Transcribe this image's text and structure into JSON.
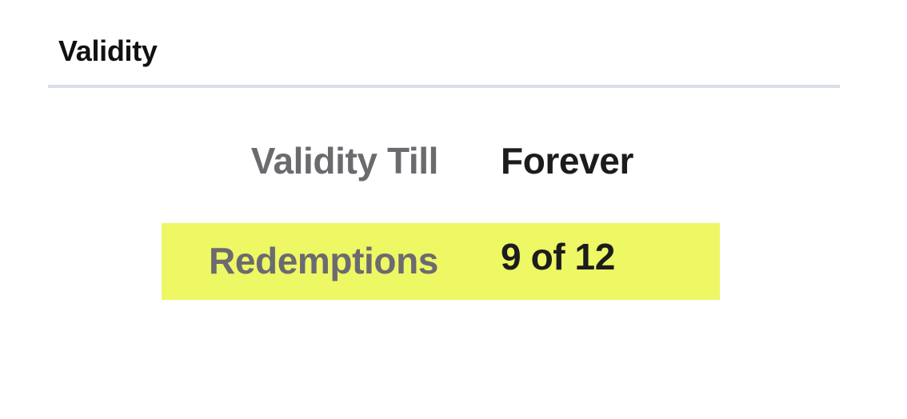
{
  "section": {
    "title": "Validity"
  },
  "details": {
    "rows": [
      {
        "label": "Validity Till",
        "value": "Forever"
      },
      {
        "label": "Redemptions",
        "value": "9 of 12"
      }
    ]
  },
  "colors": {
    "highlight": "#eef764",
    "label": "#6b6b6f",
    "value": "#1c1c1e",
    "divider": "#d8dde8"
  }
}
